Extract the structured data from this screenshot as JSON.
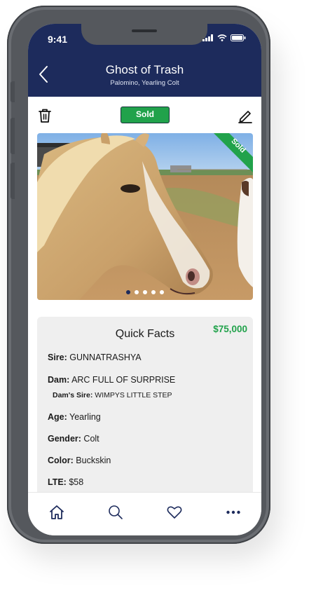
{
  "status_bar": {
    "time": "9:41"
  },
  "header": {
    "title": "Ghost of Trash",
    "subtitle": "Palomino, Yearling Colt"
  },
  "toolbar": {
    "status_badge": "Sold"
  },
  "photo": {
    "ribbon_label": "Sold",
    "image_count": 5,
    "active_index": 0
  },
  "quick_facts": {
    "title": "Quick Facts",
    "price": "$75,000",
    "items": [
      {
        "label": "Sire:",
        "value": "GUNNATRASHYA"
      },
      {
        "label": "Dam:",
        "value": "ARC FULL OF SURPRISE"
      },
      {
        "label": "Dam's Sire:",
        "value": "WIMPYS LITTLE STEP"
      },
      {
        "label": "Age:",
        "value": "Yearling"
      },
      {
        "label": "Gender:",
        "value": "Colt"
      },
      {
        "label": "Color:",
        "value": "Buckskin"
      },
      {
        "label": "LTE:",
        "value": "$58"
      }
    ]
  },
  "bottom_nav": {
    "items": [
      {
        "icon": "home-icon"
      },
      {
        "icon": "search-icon"
      },
      {
        "icon": "heart-icon"
      },
      {
        "icon": "more-icon"
      }
    ]
  },
  "colors": {
    "header_bg": "#1d2b5c",
    "accent_green": "#21a24b",
    "card_bg": "#efefef"
  }
}
